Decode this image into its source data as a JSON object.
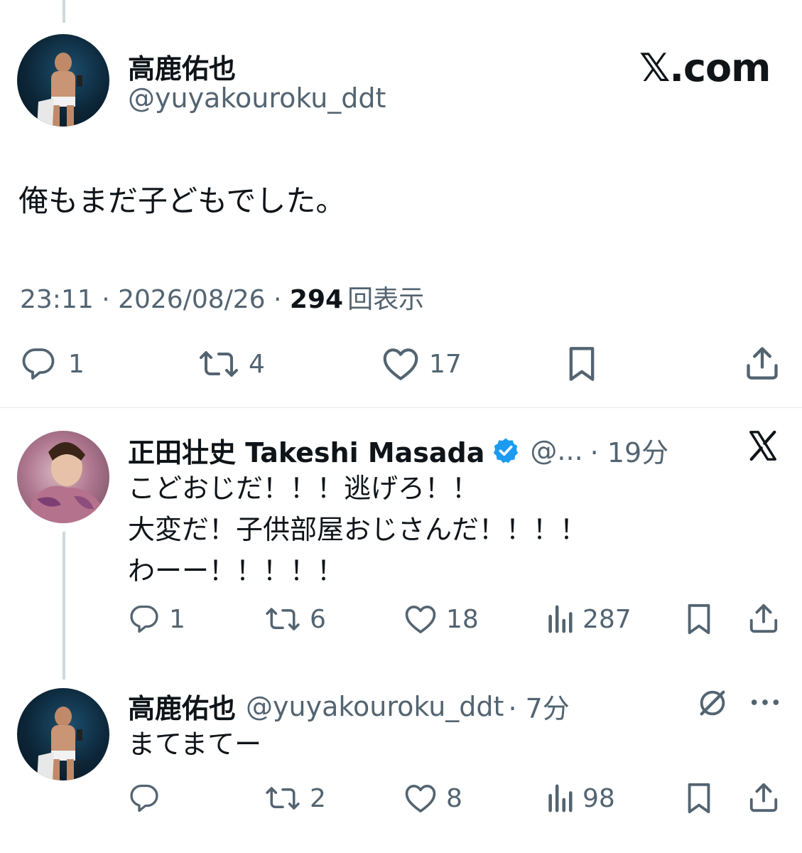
{
  "main_tweet": {
    "name": "高鹿佑也",
    "handle": "@yuyakouroku_ddt",
    "brand": "𝕏.com",
    "text": "俺もまだ子どもでした。",
    "time": "23:11 · 2026/08/26 · ",
    "views_count": "294",
    "views_label": "回表示",
    "replies": "1",
    "retweets": "4",
    "likes": "17"
  },
  "reply1": {
    "name": "正田壮史 Takeshi Masada",
    "handle": "@...",
    "time": "· 19分",
    "lines": [
      "こどおじだ！！！逃げろ！！",
      "大変だ！子供部屋おじさんだ！！！！",
      "わーー！！！！！"
    ],
    "replies": "1",
    "retweets": "6",
    "likes": "18",
    "views": "287"
  },
  "reply2": {
    "name": "高鹿佑也",
    "handle": "@yuyakouroku_ddt",
    "time": "· 7分",
    "text": "まてまてー",
    "replies": "",
    "retweets": "2",
    "likes": "8",
    "views": "98"
  },
  "colors": {
    "text": "#0f1419",
    "secondary": "#536471",
    "verified": "#1d9bf0",
    "thread_line": "#cfd9de"
  },
  "icons": [
    "reply-icon",
    "retweet-icon",
    "like-icon",
    "bookmark-icon",
    "share-icon",
    "views-icon",
    "x-logo-icon",
    "grok-icon",
    "more-icon",
    "verified-badge-icon"
  ]
}
